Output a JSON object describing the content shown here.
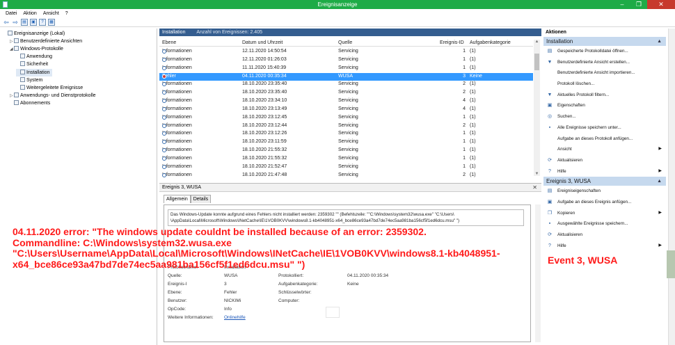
{
  "window": {
    "title": "Ereignisanzeige"
  },
  "menu": [
    "Datei",
    "Aktion",
    "Ansicht",
    "?"
  ],
  "tree": [
    {
      "label": "Ereignisanzeige (Lokal)",
      "level": 0,
      "arrow": ""
    },
    {
      "label": "Benutzerdefinierte Ansichten",
      "level": 1,
      "arrow": "▷"
    },
    {
      "label": "Windows-Protokolle",
      "level": 1,
      "arrow": "◢"
    },
    {
      "label": "Anwendung",
      "level": 2,
      "arrow": ""
    },
    {
      "label": "Sicherheit",
      "level": 2,
      "arrow": ""
    },
    {
      "label": "Installation",
      "level": 2,
      "arrow": "",
      "selected": true
    },
    {
      "label": "System",
      "level": 2,
      "arrow": ""
    },
    {
      "label": "Weitergeleitete Ereignisse",
      "level": 2,
      "arrow": ""
    },
    {
      "label": "Anwendungs- und Dienstprotokolle",
      "level": 1,
      "arrow": "▷"
    },
    {
      "label": "Abonnements",
      "level": 1,
      "arrow": ""
    }
  ],
  "log": {
    "title": "Installation",
    "count": "Anzahl von Ereignissen: 2.405",
    "columns": [
      "Ebene",
      "Datum und Uhrzeit",
      "Quelle",
      "Ereignis-ID",
      "Aufgabenkategorie"
    ],
    "rows": [
      [
        "Informationen",
        "12.11.2020 14:50:54",
        "Servicing",
        "1",
        "(1)"
      ],
      [
        "Informationen",
        "12.11.2020 01:26:03",
        "Servicing",
        "1",
        "(1)"
      ],
      [
        "Informationen",
        "11.11.2020 15:40:39",
        "Servicing",
        "1",
        "(1)"
      ],
      [
        "Fehler",
        "04.11.2020 00:35:34",
        "WUSA",
        "3",
        "Keine"
      ],
      [
        "Informationen",
        "18.10.2020 23:35:40",
        "Servicing",
        "2",
        "(1)"
      ],
      [
        "Informationen",
        "18.10.2020 23:35:40",
        "Servicing",
        "2",
        "(1)"
      ],
      [
        "Informationen",
        "18.10.2020 23:34:10",
        "Servicing",
        "4",
        "(1)"
      ],
      [
        "Informationen",
        "18.10.2020 23:13:49",
        "Servicing",
        "4",
        "(1)"
      ],
      [
        "Informationen",
        "18.10.2020 23:12:45",
        "Servicing",
        "1",
        "(1)"
      ],
      [
        "Informationen",
        "18.10.2020 23:12:44",
        "Servicing",
        "2",
        "(1)"
      ],
      [
        "Informationen",
        "18.10.2020 23:12:26",
        "Servicing",
        "1",
        "(1)"
      ],
      [
        "Informationen",
        "18.10.2020 23:11:59",
        "Servicing",
        "1",
        "(1)"
      ],
      [
        "Informationen",
        "18.10.2020 21:55:32",
        "Servicing",
        "1",
        "(1)"
      ],
      [
        "Informationen",
        "18.10.2020 21:55:32",
        "Servicing",
        "1",
        "(1)"
      ],
      [
        "Informationen",
        "18.10.2020 21:52:47",
        "Servicing",
        "1",
        "(1)"
      ],
      [
        "Informationen",
        "18.10.2020 21:47:48",
        "Servicing",
        "2",
        "(1)"
      ]
    ],
    "selected_row": 3
  },
  "detail": {
    "title": "Ereignis 3, WUSA",
    "tabs": [
      "Allgemein",
      "Details"
    ],
    "message_line1": "Das Windows-Update  konnte aufgrund eines Fehlers nicht installiert werden: 2359302 \"\" (Befehlszeile: \"\"C:\\Windows\\system32\\wusa.exe\" \"C:\\Users\\",
    "message_line2": "\\AppData\\Local\\Microsoft\\Windows\\INetCache\\IE\\1VOB0KVV\\windows8.1-kb4048951-x64_bce86ce93a47bd7de74ec5aa981ba156cf5f1ed6dcu.msu\" \")",
    "fields": {
      "protokollname_label": "Protokollname:",
      "protokollname": "Installation",
      "quelle_label": "Quelle:",
      "quelle": "WUSA",
      "protokolliert_label": "Protokolliert:",
      "protokolliert": "04.11.2020 00:35:34",
      "ereignis_label": "Ereignis-I",
      "ereignis": "3",
      "aufgabe_label": "Aufgabenkategorie:",
      "aufgabe": "Keine",
      "ebene_label": "Ebene:",
      "ebene": "Fehler",
      "schluessel_label": "Schlüsselwörter:",
      "benutzer_label": "Benutzer:",
      "benutzer": "NICKIMi",
      "computer_label": "Computer:",
      "opcode_label": "OpCode:",
      "opcode": "Info",
      "weitere_label": "Weitere Informationen:",
      "weitere_link": "Onlinehilfe"
    }
  },
  "actions": {
    "header": "Aktionen",
    "section1": "Installation",
    "items1": [
      {
        "icon": "folder-icon",
        "glyph": "▤",
        "label": "Gespeicherte Protokolldatei öffnen..."
      },
      {
        "icon": "filter-icon",
        "glyph": "▼",
        "label": "Benutzerdefinierte Ansicht erstellen..."
      },
      {
        "icon": "",
        "glyph": "",
        "label": "Benutzerdefinierte Ansicht importieren..."
      },
      {
        "icon": "",
        "glyph": "",
        "label": "Protokoll löschen..."
      },
      {
        "icon": "filter-icon",
        "glyph": "▼",
        "label": "Aktuelles Protokoll filtern..."
      },
      {
        "icon": "properties-icon",
        "glyph": "▣",
        "label": "Eigenschaften"
      },
      {
        "icon": "find-icon",
        "glyph": "◎",
        "label": "Suchen..."
      },
      {
        "icon": "save-icon",
        "glyph": "▪",
        "label": "Alle Ereignisse speichern unter..."
      },
      {
        "icon": "",
        "glyph": "",
        "label": "Aufgabe an dieses Protokoll anfügen..."
      },
      {
        "icon": "",
        "glyph": "",
        "label": "Ansicht",
        "submenu": true
      },
      {
        "icon": "refresh-icon",
        "glyph": "⟳",
        "label": "Aktualisieren"
      },
      {
        "icon": "help-icon",
        "glyph": "?",
        "label": "Hilfe",
        "submenu": true
      }
    ],
    "section2": "Ereignis 3, WUSA",
    "items2": [
      {
        "icon": "event-properties-icon",
        "glyph": "▤",
        "label": "Ereigniseigenschaften"
      },
      {
        "icon": "task-icon",
        "glyph": "▣",
        "label": "Aufgabe an dieses Ereignis anfügen..."
      },
      {
        "icon": "copy-icon",
        "glyph": "❐",
        "label": "Kopieren",
        "submenu": true
      },
      {
        "icon": "save-icon",
        "glyph": "▪",
        "label": "Ausgewählte Ereignisse speichern..."
      },
      {
        "icon": "refresh-icon",
        "glyph": "⟳",
        "label": "Aktualisieren"
      },
      {
        "icon": "help-icon",
        "glyph": "?",
        "label": "Hilfe",
        "submenu": true
      }
    ]
  },
  "annotation_left": [
    "04.11.2020 error: \"The windows update couldnt be installed because of an error: 2359302.",
    "Commandline: C:\\Windows\\system32.wusa.exe",
    "\"C:\\Users\\Username\\AppData\\Local\\Microsoft\\Windows\\INetCache\\IE\\1VOB0KVV\\windows8.1-kb4048951-",
    "x64_bce86ce93a47bd7de74ec5aa981ba156cf5f1ed6dcu.msu\" \")"
  ],
  "annotation_right": "Event 3, WUSA"
}
